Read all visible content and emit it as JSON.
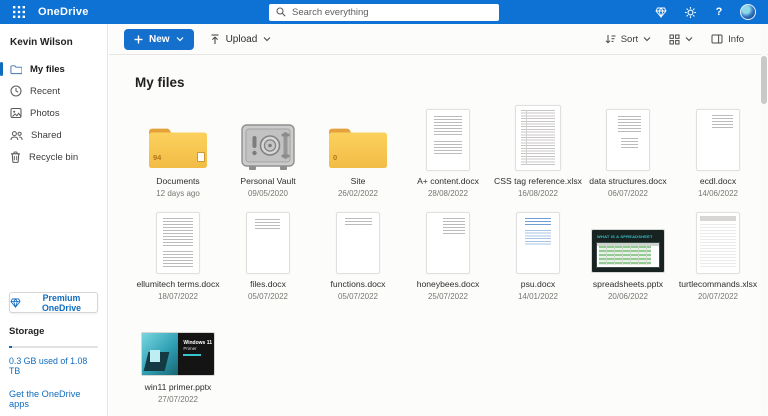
{
  "topbar": {
    "title": "OneDrive",
    "search_placeholder": "Search everything",
    "help_label": "?"
  },
  "sidebar": {
    "user_name": "Kevin Wilson",
    "items": [
      {
        "label": "My files"
      },
      {
        "label": "Recent"
      },
      {
        "label": "Photos"
      },
      {
        "label": "Shared"
      },
      {
        "label": "Recycle bin"
      }
    ],
    "premium_label": "Premium OneDrive",
    "storage_heading": "Storage",
    "storage_usage": "0.3 GB used of 1.08 TB",
    "apps_link": "Get the OneDrive apps"
  },
  "toolbar": {
    "new_label": "New",
    "upload_label": "Upload",
    "sort_label": "Sort",
    "info_label": "Info"
  },
  "main": {
    "heading": "My files",
    "items": [
      {
        "name": "Documents",
        "meta": "12 days ago",
        "count": "94"
      },
      {
        "name": "Personal Vault",
        "meta": "09/05/2020"
      },
      {
        "name": "Site",
        "meta": "26/02/2022",
        "count": "0"
      },
      {
        "name": "A+ content.docx",
        "meta": "28/08/2022"
      },
      {
        "name": "CSS tag reference.xlsx",
        "meta": "16/08/2022"
      },
      {
        "name": "data structures.docx",
        "meta": "06/07/2022"
      },
      {
        "name": "ecdl.docx",
        "meta": "14/06/2022"
      },
      {
        "name": "ellumitech terms.docx",
        "meta": "18/07/2022"
      },
      {
        "name": "files.docx",
        "meta": "05/07/2022"
      },
      {
        "name": "functions.docx",
        "meta": "05/07/2022"
      },
      {
        "name": "honeybees.docx",
        "meta": "25/07/2022"
      },
      {
        "name": "psu.docx",
        "meta": "14/01/2022"
      },
      {
        "name": "spreadsheets.pptx",
        "meta": "20/06/2022"
      },
      {
        "name": "turtlecommands.xlsx",
        "meta": "20/07/2022"
      },
      {
        "name": "win11 primer.pptx",
        "meta": "27/07/2022"
      }
    ],
    "slide_texts": {
      "spreadsheet_title": "WHAT IS A SPREADSHEET",
      "win11_line1": "Windows 11",
      "win11_line2": "Primer"
    }
  },
  "colors": {
    "accent": "#0f6cbd",
    "topbar": "#0d72d4",
    "folder": "#fbd15e"
  }
}
